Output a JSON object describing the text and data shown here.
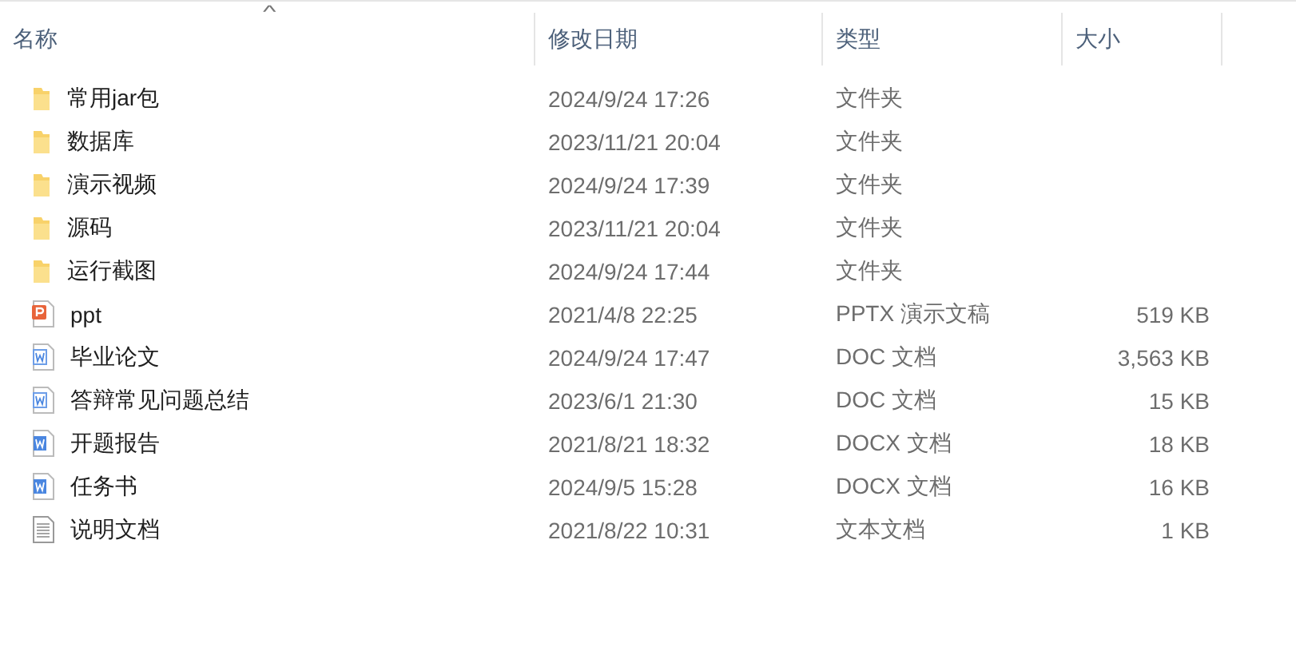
{
  "columns": [
    {
      "label": "名称",
      "sorted": true
    },
    {
      "label": "修改日期",
      "sorted": false
    },
    {
      "label": "类型",
      "sorted": false
    },
    {
      "label": "大小",
      "sorted": false
    }
  ],
  "sort_indicator": "^",
  "files": [
    {
      "name": "常用jar包",
      "modified": "2024/9/24 17:26",
      "type": "文件夹",
      "kind": "folder"
    },
    {
      "name": "数据库",
      "modified": "2023/11/21 20:04",
      "type": "文件夹",
      "kind": "folder"
    },
    {
      "name": "演示视频",
      "modified": "2024/9/24 17:39",
      "type": "文件夹",
      "kind": "folder"
    },
    {
      "name": "源码",
      "modified": "2023/11/21 20:04",
      "type": "文件夹",
      "kind": "folder"
    },
    {
      "name": "运行截图",
      "modified": "2024/9/24 17:44",
      "type": "文件夹",
      "kind": "folder"
    },
    {
      "name": "ppt",
      "modified": "2021/4/8 22:25",
      "type": "PPTX 演示文稿",
      "size": "519 KB",
      "kind": "ppt"
    },
    {
      "name": "毕业论文",
      "modified": "2024/9/24 17:47",
      "type": "DOC 文档",
      "size": "3,563 KB",
      "kind": "doc"
    },
    {
      "name": "答辩常见问题总结",
      "modified": "2023/6/1 21:30",
      "type": "DOC 文档",
      "size": "15 KB",
      "kind": "doc"
    },
    {
      "name": "开题报告",
      "modified": "2021/8/21 18:32",
      "type": "DOCX 文档",
      "size": "18 KB",
      "kind": "docx"
    },
    {
      "name": "任务书",
      "modified": "2024/9/5 15:28",
      "type": "DOCX 文档",
      "size": "16 KB",
      "kind": "docx"
    },
    {
      "name": "说明文档",
      "modified": "2021/8/22 10:31",
      "type": "文本文档",
      "size": "1 KB",
      "kind": "txt"
    }
  ]
}
